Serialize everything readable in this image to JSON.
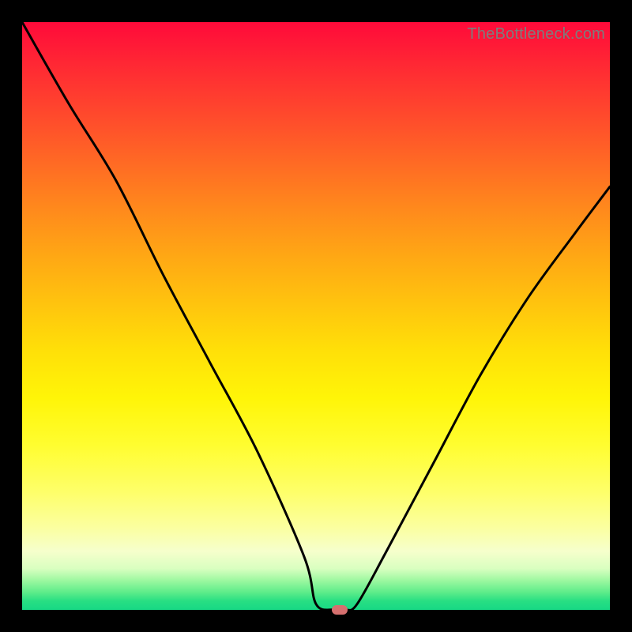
{
  "watermark": "TheBottleneck.com",
  "chart_data": {
    "type": "line",
    "title": "",
    "xlabel": "",
    "ylabel": "",
    "xlim": [
      0,
      100
    ],
    "ylim": [
      0,
      100
    ],
    "series": [
      {
        "name": "bottleneck-curve",
        "x": [
          0,
          8,
          16,
          24,
          32,
          40,
          48,
          50,
          53,
          55,
          57,
          62,
          70,
          78,
          86,
          94,
          100
        ],
        "values": [
          100,
          86,
          73,
          57,
          42,
          27,
          9,
          1,
          0,
          0,
          1,
          10,
          25,
          40,
          53,
          64,
          72
        ]
      }
    ],
    "marker": {
      "x": 54,
      "y": 0
    },
    "background_gradient": {
      "top": "#ff0a3a",
      "mid": "#fff508",
      "bottom": "#17d884"
    }
  }
}
